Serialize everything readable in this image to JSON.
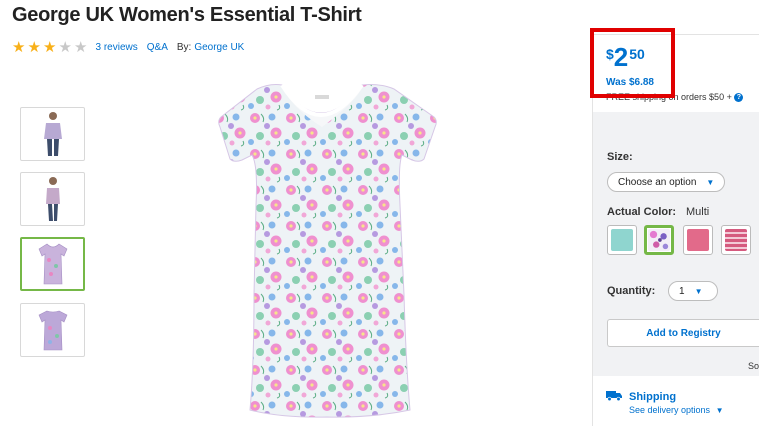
{
  "product": {
    "title": "George UK Women's Essential T-Shirt",
    "rating": 3,
    "rating_max": 5,
    "reviews_label": "3 reviews",
    "qa_label": "Q&A",
    "by_label": "By:",
    "brand_label": "George UK"
  },
  "price": {
    "currency": "$",
    "dollars": "2",
    "cents": "50",
    "was_label": "Was $6.88",
    "free_shipping": "FREE shipping on orders $50 +"
  },
  "options": {
    "size_label": "Size:",
    "size_placeholder": "Choose an option",
    "color_label": "Actual Color:",
    "color_value": "Multi",
    "swatches": [
      {
        "name": "aqua",
        "color": "#8fd5cf",
        "selected": false
      },
      {
        "name": "multi floral",
        "color": "#b48ac7",
        "selected": true
      },
      {
        "name": "pink",
        "color": "#e26a8a",
        "selected": false
      },
      {
        "name": "pink stripe",
        "color": "#d55a7e",
        "selected": false
      }
    ],
    "quantity_label": "Quantity:",
    "quantity_value": "1"
  },
  "actions": {
    "registry_label": "Add to Registry",
    "sold_label": "Sol"
  },
  "shipping": {
    "title": "Shipping",
    "link": "See delivery options"
  },
  "colors": {
    "accent": "#0071ce",
    "highlight_border": "#e00000",
    "selected_border": "#75b847",
    "star": "#f8b019"
  },
  "thumbnails": [
    {
      "name": "thumb-model-front",
      "selected": false
    },
    {
      "name": "thumb-model-side",
      "selected": false
    },
    {
      "name": "thumb-shirt-front",
      "selected": true
    },
    {
      "name": "thumb-shirt-back",
      "selected": false
    }
  ]
}
